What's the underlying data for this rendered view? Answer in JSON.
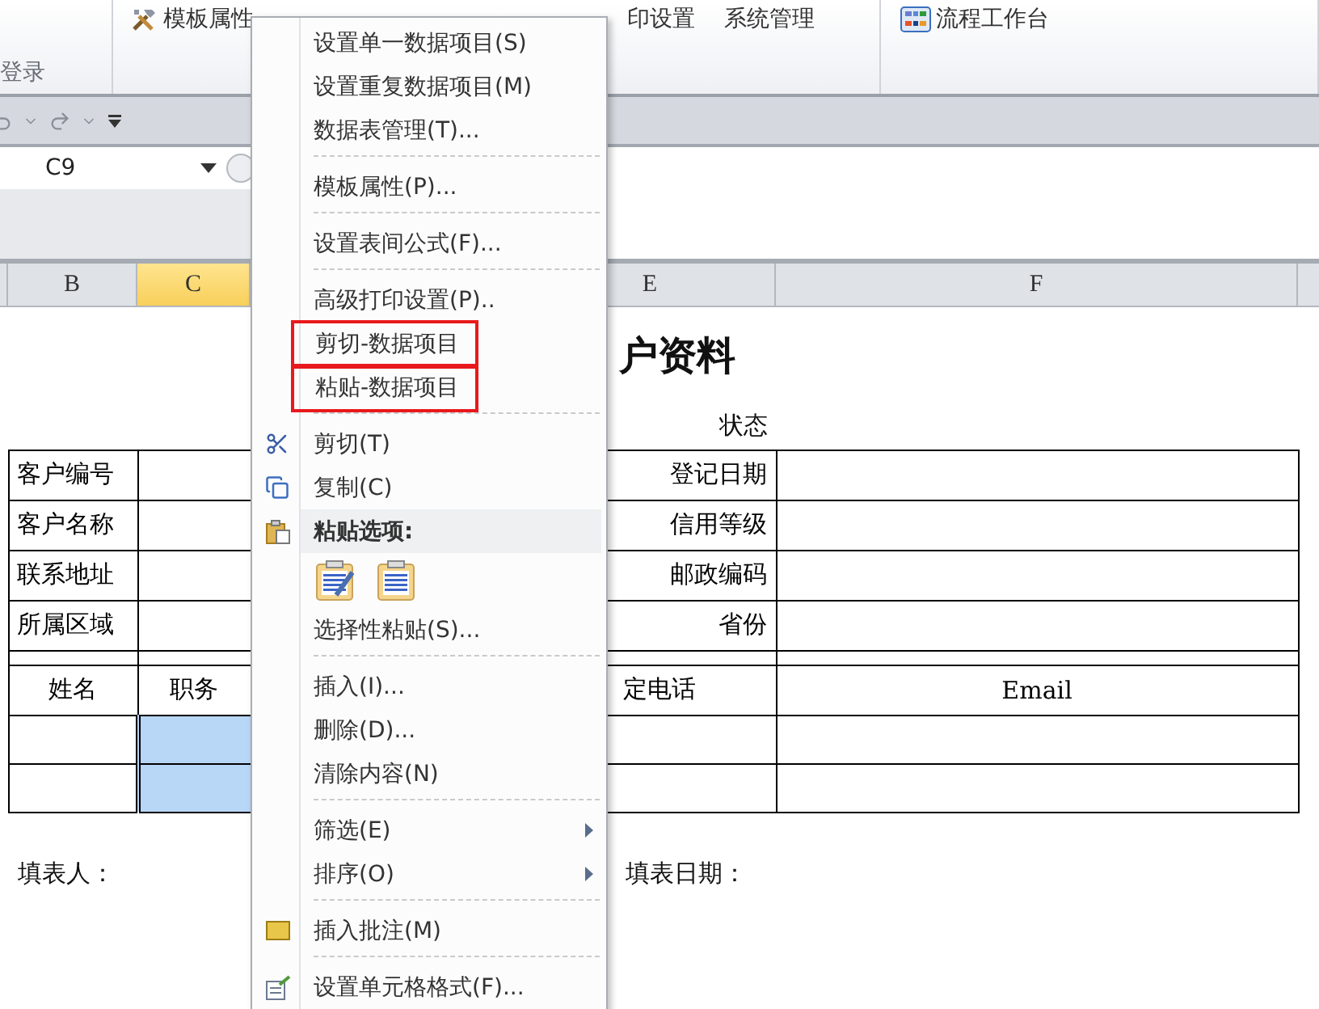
{
  "ribbon": {
    "group_label": "登录",
    "buttons": [
      {
        "label": "模板属性"
      },
      {
        "label": "印设置"
      },
      {
        "label": "系统管理"
      },
      {
        "label": "流程工作台"
      }
    ]
  },
  "name_box": {
    "value": "C9"
  },
  "columns": [
    {
      "label": "B",
      "selected": false
    },
    {
      "label": "C",
      "selected": true
    },
    {
      "label": "E",
      "selected": false
    },
    {
      "label": "F",
      "selected": false
    }
  ],
  "sheet": {
    "title": "户资料",
    "status_label": "状态",
    "form_rows": [
      {
        "left": "客户编号",
        "right": "登记日期"
      },
      {
        "left": "客户名称",
        "right": "信用等级"
      },
      {
        "left": "联系地址",
        "right": "邮政编码"
      },
      {
        "left": "所属区域",
        "right": "省份"
      }
    ],
    "table_headers": [
      "姓名",
      "职务",
      "定电话",
      "Email"
    ],
    "entry_rows": [
      {
        "job_cell_selected": true
      },
      {
        "job_cell_selected": true
      }
    ],
    "filled_by": "填表人：",
    "fill_date": "填表日期："
  },
  "context_menu": {
    "items": [
      {
        "kind": "command",
        "label": "设置单一数据项目(S)",
        "boxed": false,
        "submenu": false
      },
      {
        "kind": "command",
        "label": "设置重复数据项目(M)",
        "boxed": false,
        "submenu": false
      },
      {
        "kind": "command",
        "label": "数据表管理(T)...",
        "boxed": false,
        "submenu": false
      },
      {
        "kind": "separator"
      },
      {
        "kind": "command",
        "label": "模板属性(P)...",
        "boxed": false,
        "submenu": false
      },
      {
        "kind": "separator"
      },
      {
        "kind": "command",
        "label": "设置表间公式(F)...",
        "boxed": false,
        "submenu": false
      },
      {
        "kind": "separator"
      },
      {
        "kind": "command",
        "label": "高级打印设置(P)..",
        "boxed": false,
        "submenu": false
      },
      {
        "kind": "command",
        "label": "剪切-数据项目",
        "boxed": true,
        "submenu": false
      },
      {
        "kind": "command",
        "label": "粘贴-数据项目",
        "boxed": true,
        "submenu": false
      },
      {
        "kind": "separator"
      },
      {
        "kind": "command",
        "label": "剪切(T)",
        "boxed": false,
        "submenu": false
      },
      {
        "kind": "command",
        "label": "复制(C)",
        "boxed": false,
        "submenu": false
      },
      {
        "kind": "header",
        "label": "粘贴选项:"
      },
      {
        "kind": "paste-options"
      },
      {
        "kind": "command",
        "label": "选择性粘贴(S)...",
        "boxed": false,
        "submenu": false
      },
      {
        "kind": "separator"
      },
      {
        "kind": "command",
        "label": "插入(I)...",
        "boxed": false,
        "submenu": false
      },
      {
        "kind": "command",
        "label": "删除(D)...",
        "boxed": false,
        "submenu": false
      },
      {
        "kind": "command",
        "label": "清除内容(N)",
        "boxed": false,
        "submenu": false
      },
      {
        "kind": "separator"
      },
      {
        "kind": "command",
        "label": "筛选(E)",
        "boxed": false,
        "submenu": true
      },
      {
        "kind": "command",
        "label": "排序(O)",
        "boxed": false,
        "submenu": true
      },
      {
        "kind": "separator"
      },
      {
        "kind": "command",
        "label": "插入批注(M)",
        "boxed": false,
        "submenu": false
      },
      {
        "kind": "separator"
      },
      {
        "kind": "command",
        "label": "设置单元格格式(F)...",
        "boxed": false,
        "submenu": false
      }
    ]
  }
}
